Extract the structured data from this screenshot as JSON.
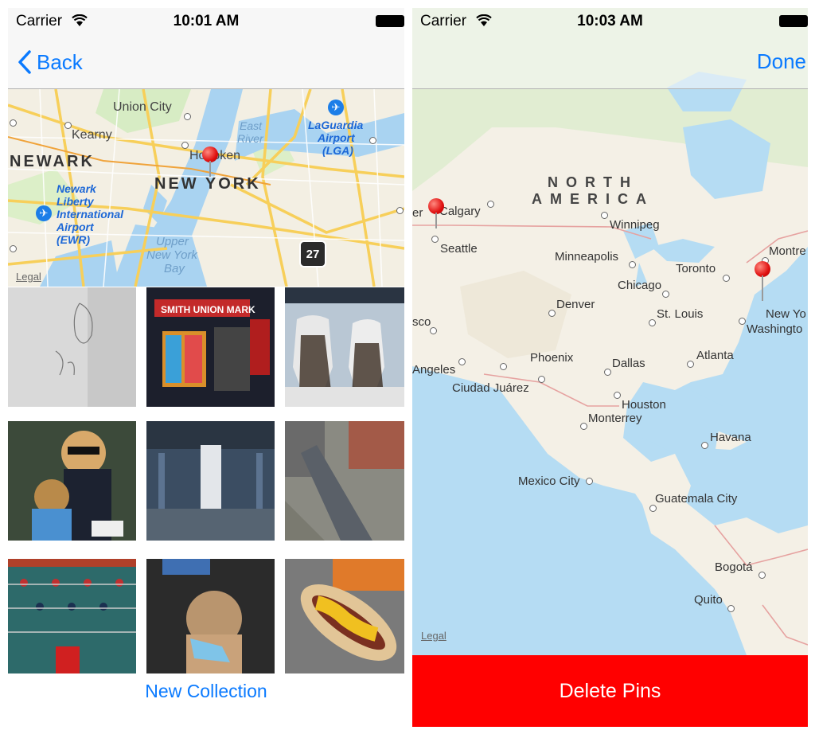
{
  "left": {
    "status": {
      "carrier": "Carrier",
      "time": "10:01 AM"
    },
    "nav": {
      "back_label": "Back"
    },
    "map": {
      "labels": {
        "union_city": "Union City",
        "kearny": "Kearny",
        "east_river_1": "East",
        "east_river_2": "River",
        "laguardia_1": "LaGuardia",
        "laguardia_2": "Airport",
        "laguardia_3": "(LGA)",
        "newark": "NEWARK",
        "hoboken": "Hoboken",
        "new_york": "NEW YORK",
        "newark_airport_1": "Newark",
        "newark_airport_2": "Liberty",
        "newark_airport_3": "International",
        "newark_airport_4": "Airport",
        "newark_airport_5": "(EWR)",
        "upper_bay_1": "Upper",
        "upper_bay_2": "New York",
        "upper_bay_3": "Bay"
      },
      "route_number": "27",
      "legal": "Legal"
    },
    "photos": [
      {
        "name": "sketch-drawing"
      },
      {
        "name": "storefront-market"
      },
      {
        "name": "mannequins-window"
      },
      {
        "name": "woman-with-dog"
      },
      {
        "name": "subway-station"
      },
      {
        "name": "street-aerial"
      },
      {
        "name": "foosball-table"
      },
      {
        "name": "dog-costume"
      },
      {
        "name": "hot-dog"
      }
    ],
    "new_collection_label": "New Collection"
  },
  "right": {
    "status": {
      "carrier": "Carrier",
      "time": "10:03 AM"
    },
    "nav": {
      "done_label": "Done"
    },
    "map": {
      "continent_1": "NORTH",
      "continent_2": "AMERICA",
      "cities": {
        "calgary": "Calgary",
        "winnipeg": "Winnipeg",
        "seattle": "Seattle",
        "minneapolis": "Minneapolis",
        "toronto": "Toronto",
        "montreal": "Montre",
        "chicago": "Chicago",
        "denver": "Denver",
        "st_louis": "St. Louis",
        "new_york": "New Yo",
        "washington": "Washingto",
        "sf": "sco",
        "los_angeles": "Angeles",
        "phoenix": "Phoenix",
        "dallas": "Dallas",
        "atlanta": "Atlanta",
        "ciudad_juarez": "Ciudad Juárez",
        "houston": "Houston",
        "monterrey": "Monterrey",
        "havana": "Havana",
        "mexico_city": "Mexico City",
        "guatemala": "Guatemala City",
        "bogota": "Bogotá",
        "quito": "Quito",
        "vancouver": "er"
      },
      "legal": "Legal"
    },
    "delete_label": "Delete Pins"
  }
}
